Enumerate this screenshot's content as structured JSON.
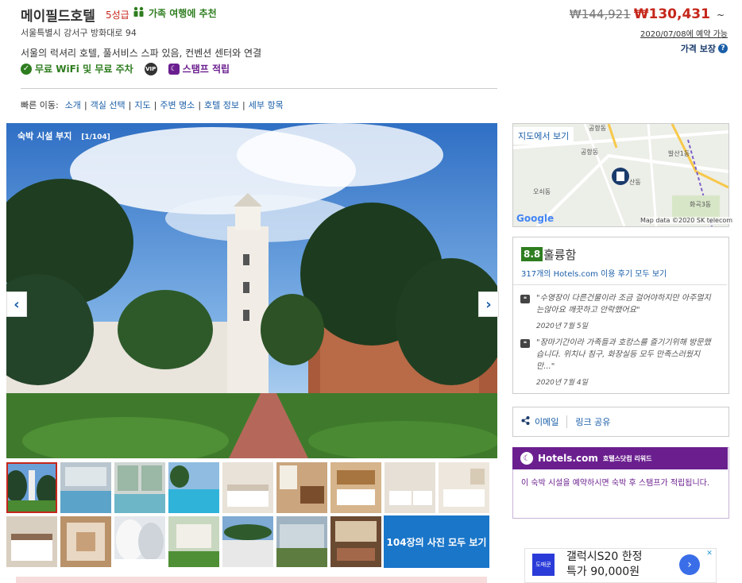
{
  "hotel": {
    "name": "메이필드호텔",
    "stars": "5성급",
    "family_badge": "가족 여행에 추천",
    "address": "서울특별시 강서구 방화대로 94",
    "tagline": "서울의 럭셔리 호텔, 풀서비스 스파 있음, 컨벤션 센터와 연결",
    "amenity_wifi": "무료 WiFi 및 무료 주차",
    "vip_label": "VIP",
    "stamp_label": "스탬프 적립"
  },
  "price": {
    "old": "₩144,921",
    "new": "₩130,431",
    "tilde": "~",
    "availability": "2020/07/08에 예약 가능",
    "guarantee": "가격 보장"
  },
  "quick_nav": {
    "label": "빠른 이동:",
    "links": [
      "소개",
      "객실 선택",
      "지도",
      "주변 명소",
      "호텔 정보",
      "세부 항목"
    ]
  },
  "gallery": {
    "caption": "숙박 시설 부지",
    "count": "[1/104]",
    "see_all": "104장의 사진 모두 보기"
  },
  "map": {
    "button": "지도에서 보기",
    "google": "Google",
    "attribution": "Map data ©2020 SK telecom",
    "labels": [
      "공항동",
      "공항동",
      "발산1동",
      "오쇠동",
      "화곡3동",
      "산동"
    ]
  },
  "reviews": {
    "score": "8.8",
    "score_word": "훌륭함",
    "count_link": "317개의 Hotels.com 이용 후기 모두 보기",
    "items": [
      {
        "text": "\"수영장이 다른건물이라 조금 걸어야하지만 아주멀지는않아요 깨끗하고 안락했어요\"",
        "date": "2020년 7월 5일"
      },
      {
        "text": "\"장마기간이라 가족들과 호캉스를 즐기기위해 방문했습니다. 위치나 침구, 화장실등 모두 만족스러웠지만...\"",
        "date": "2020년 7월 4일"
      }
    ]
  },
  "share": {
    "email": "이메일",
    "link": "링크 공유"
  },
  "stamp_panel": {
    "brand": "Hotels.com",
    "sub": "호텔스닷컴 리워드",
    "body": "이 숙박 시설을 예약하시면 숙박 후 스탬프가 적립됩니다."
  },
  "ad": {
    "logo": "도매쿤",
    "line1": "갤럭시S20 한정",
    "line2": "특가 90,000원"
  }
}
